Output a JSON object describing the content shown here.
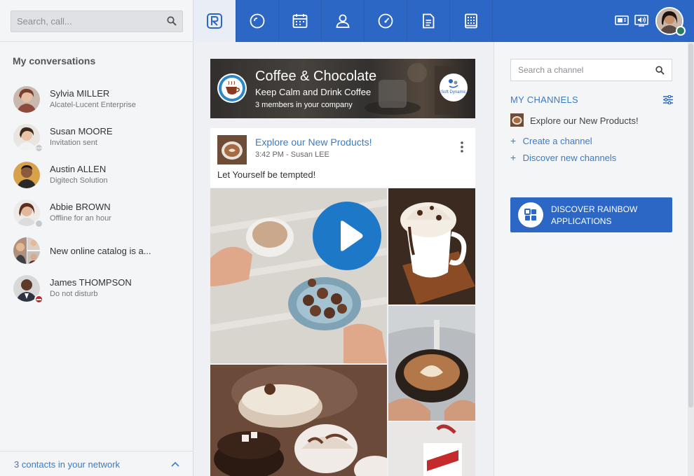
{
  "sidebar": {
    "search_placeholder": "Search, call...",
    "heading": "My conversations",
    "conversations": [
      {
        "name": "Sylvia MILLER",
        "sub": "Alcatel-Lucent Enterprise",
        "status": "none"
      },
      {
        "name": "Susan MOORE",
        "sub": "Invitation sent",
        "status": "invited"
      },
      {
        "name": "Austin ALLEN",
        "sub": "Digitech Solution",
        "status": "none"
      },
      {
        "name": "Abbie BROWN",
        "sub": "Offline for an hour",
        "status": "offline"
      },
      {
        "name": "New online catalog is a...",
        "status": "group"
      },
      {
        "name": "James THOMPSON",
        "sub": "Do not disturb",
        "status": "dnd"
      }
    ],
    "footer_text": "3 contacts in your network"
  },
  "topbar": {
    "nav_icons": [
      "rainbow-logo-icon",
      "recent-icon",
      "calendar-icon",
      "contact-icon",
      "dashboard-icon",
      "document-icon",
      "pbx-icon"
    ],
    "right_icons": [
      "phone-card-icon",
      "speaker-icon"
    ],
    "accent_color": "#2c67c6"
  },
  "channel": {
    "title": "Coffee & Chocolate",
    "subtitle": "Keep Calm and Drink Coffee",
    "members": "3 members in your company",
    "partner_logo_text": "Soft Dynamic"
  },
  "post": {
    "title": "Explore our New Products!",
    "meta": "3:42 PM - Susan LEE",
    "text": "Let Yourself be tempted!"
  },
  "right_panel": {
    "search_placeholder": "Search a channel",
    "my_channels_label": "MY CHANNELS",
    "channel_item": "Explore our New Products!",
    "create_label": "Create a channel",
    "discover_label": "Discover new channels",
    "discover_button": "DISCOVER RAINBOW APPLICATIONS"
  }
}
